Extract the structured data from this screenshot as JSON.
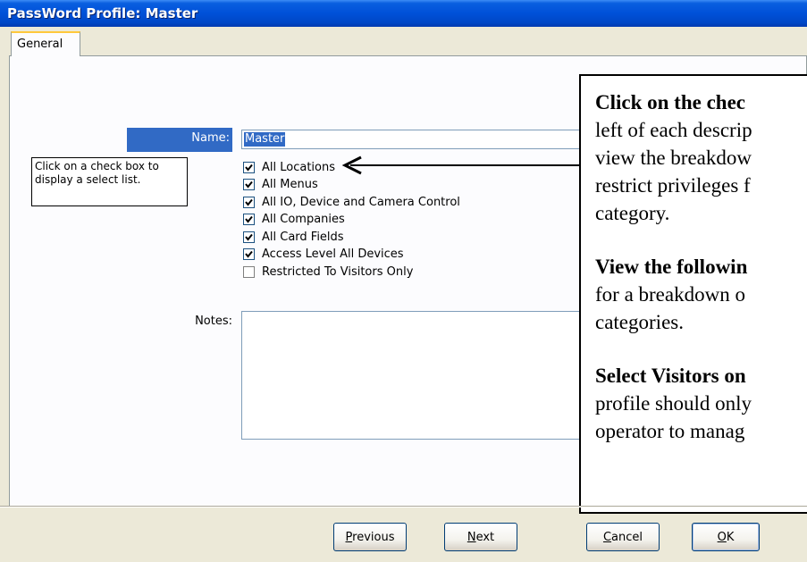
{
  "window": {
    "title": "PassWord Profile: Master"
  },
  "tabs": [
    {
      "label": "General"
    }
  ],
  "form": {
    "name_label": "Name:",
    "name_value": "Master",
    "notes_label": "Notes:",
    "notes_value": ""
  },
  "hint": {
    "text": "Click on a check box to display a select list."
  },
  "checkboxes": [
    {
      "label": "All Locations",
      "checked": true
    },
    {
      "label": "All Menus",
      "checked": true
    },
    {
      "label": "All IO, Device and Camera Control",
      "checked": true
    },
    {
      "label": "All Companies",
      "checked": true
    },
    {
      "label": "All Card Fields",
      "checked": true
    },
    {
      "label": "Access Level All Devices",
      "checked": true
    },
    {
      "label": "Restricted To Visitors Only",
      "checked": false
    }
  ],
  "instructions": {
    "p1_bold": "Click on the chec",
    "p1_line2": "left of each descrip",
    "p1_line3": "view the breakdow",
    "p1_line4": "restrict privileges f",
    "p1_line5": "category.",
    "p2_bold": "View the followin",
    "p2_line2": "for a breakdown o",
    "p2_line3": "categories.",
    "p3_bold": "Select Visitors on",
    "p3_line2": "profile should only",
    "p3_line3": "operator to manag"
  },
  "buttons": {
    "previous_mnemonic": "P",
    "previous_rest": "revious",
    "next_mnemonic": "N",
    "next_rest": "ext",
    "cancel_mnemonic": "C",
    "cancel_rest": "ancel",
    "ok_mnemonic": "O",
    "ok_rest": "K"
  },
  "colors": {
    "titlebar": "#0050d8",
    "selection": "#316ac5",
    "dialog_bg": "#ece9d8"
  }
}
